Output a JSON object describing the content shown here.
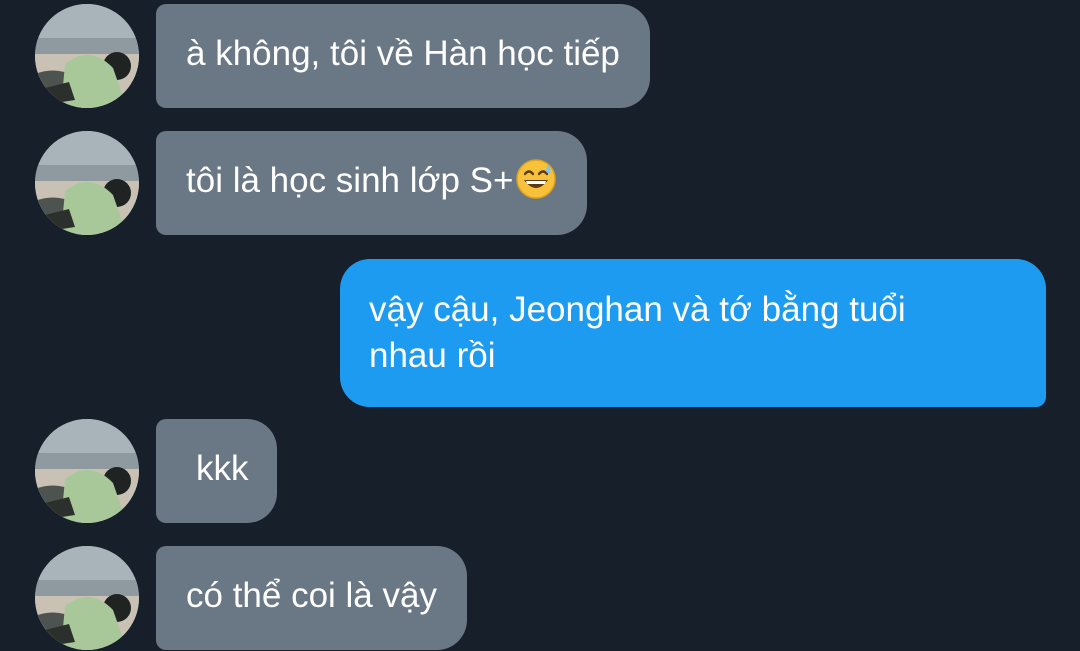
{
  "conversation": {
    "messages": [
      {
        "direction": "received",
        "text": "à không, tôi về Hàn học tiếp"
      },
      {
        "direction": "received",
        "text": "tôi là học sinh lớp S+",
        "emoji": "grinning-face-with-sweat-icon"
      },
      {
        "direction": "sent",
        "line1": "vậy cậu, Jeonghan và tớ bằng tuổi",
        "line2": "nhau rồi"
      },
      {
        "direction": "received",
        "text": "kkk"
      },
      {
        "direction": "received",
        "text": "có thể coi là vậy"
      }
    ]
  },
  "colors": {
    "background": "#17202a",
    "received_bubble": "#6a7785",
    "sent_bubble": "#1d9bf0",
    "text": "#ffffff"
  }
}
